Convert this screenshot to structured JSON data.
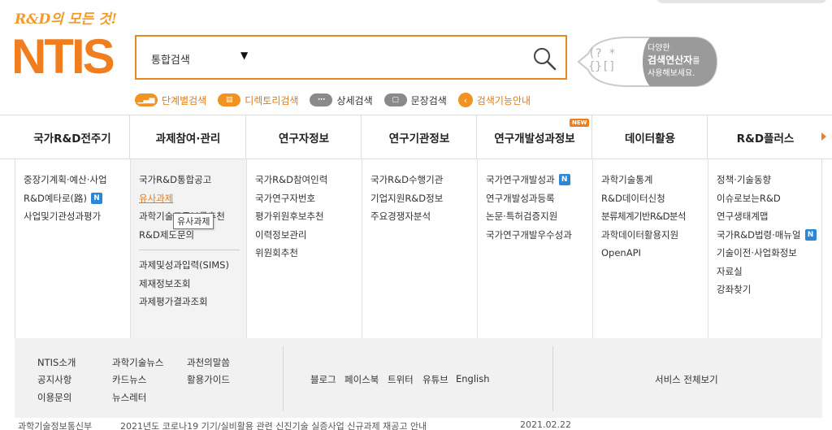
{
  "logo": {
    "slogan": "R&D의 모든 것!",
    "name": "NTIS"
  },
  "search": {
    "select_value": "통합검색",
    "input_value": "",
    "bubble_line1": "다양한",
    "bubble_line2_bold": "검색연산자",
    "bubble_line2_tail": "를",
    "bubble_line3": "사용해보세요.",
    "bubble_glyph_top": "(? *",
    "bubble_glyph_bottom": " {}[]"
  },
  "quick_links": [
    {
      "label": "단계별검색"
    },
    {
      "label": "디렉토리검색"
    },
    {
      "label": "상세검색"
    },
    {
      "label": "문장검색"
    },
    {
      "label": "검색기능안내"
    }
  ],
  "nav": [
    {
      "label": "국가R&D전주기"
    },
    {
      "label": "과제참여·관리"
    },
    {
      "label": "연구자정보"
    },
    {
      "label": "연구기관정보"
    },
    {
      "label": "연구개발성과정보",
      "badge": "NEW"
    },
    {
      "label": "데이터활용"
    },
    {
      "label": "R&D플러스"
    }
  ],
  "menu": {
    "col1": [
      "중장기계획·예산·사업",
      "R&D예타로(路)",
      "사업및기관성과평가"
    ],
    "col2a": [
      "국가R&D통합공고",
      "유사과제",
      "과학기술표준분류추천",
      "R&D제도문의"
    ],
    "col2b": [
      "과제및성과입력(SIMS)",
      "제재정보조회",
      "과제평가결과조회"
    ],
    "col3": [
      "국가R&D참여인력",
      "국가연구자번호",
      "평가위원후보추천",
      "이력정보관리",
      "위원회추천"
    ],
    "col4": [
      "국가R&D수행기관",
      "기업지원R&D정보",
      "주요경쟁자분석"
    ],
    "col5": [
      "국가연구개발성과",
      "연구개발성과등록",
      "논문·특허검증지원",
      "국가연구개발우수성과"
    ],
    "col6": [
      "과학기술통계",
      "R&D데이터신청",
      "분류체계기반R&D분석",
      "과학데이터활용지원",
      "OpenAPI"
    ],
    "col7": [
      "정책·기술동향",
      "이슈로보는R&D",
      "연구생태계맵",
      "국가R&D법령·매뉴얼",
      "기술이전·사업화정보",
      "자료실",
      "강좌찾기"
    ],
    "n_badge": "N",
    "tooltip": "유사과제"
  },
  "footer": {
    "left": [
      "NTIS소개",
      "과학기술뉴스",
      "과천의말씀",
      "공지사항",
      "카드뉴스",
      "활용가이드",
      "이용문의",
      "뉴스레터"
    ],
    "social": [
      "블로그",
      "페이스북",
      "트위터",
      "유튜브",
      "English"
    ],
    "all_services": "서비스 전체보기"
  },
  "bottom": {
    "left_text": "과학기술정보통신부",
    "mid_text": "2021년도 코로나19 기기/실비활용 관련 신진기술 실증사업 신규과제 재공고 안내",
    "date": "2021.02.22"
  },
  "colors": {
    "accent": "#f07e1e",
    "badge_blue": "#2d87d8"
  }
}
